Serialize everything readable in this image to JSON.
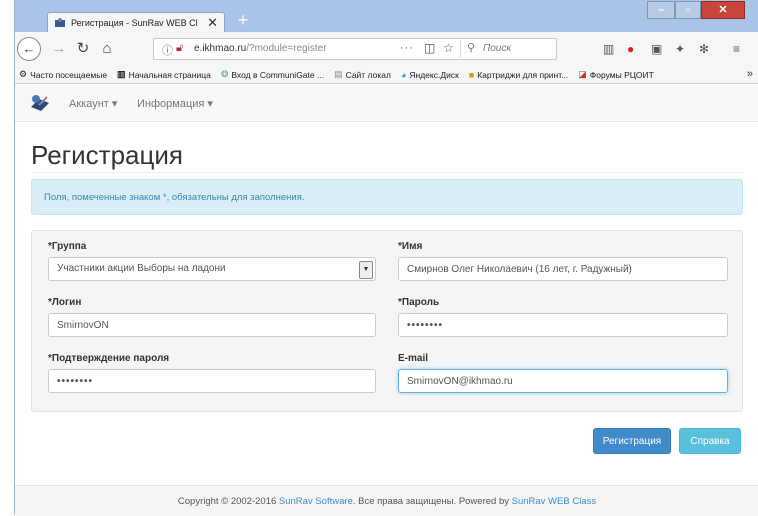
{
  "browser": {
    "tab_title": "Регистрация - SunRav WEB Cl",
    "tab_close": "✕",
    "new_tab": "+",
    "url_prefix": "e.ikhmao.ru",
    "url_path": "/?module=register",
    "url_more": "···",
    "search_placeholder": "Поиск",
    "bookmarks": [
      {
        "label": "Часто посещаемые",
        "icon": "gear-icon"
      },
      {
        "label": "Начальная страница",
        "icon": "start-page-icon"
      },
      {
        "label": "Вход в CommuniGate ...",
        "icon": "communigate-icon"
      },
      {
        "label": "Сайт локал",
        "icon": "page-icon"
      },
      {
        "label": "Яндекс.Диск",
        "icon": "disk-icon"
      },
      {
        "label": "Картриджи для принт...",
        "icon": "folder-icon"
      },
      {
        "label": "Форумы РЦОИТ",
        "icon": "forum-icon"
      }
    ],
    "bookmarks_more": "»"
  },
  "header": {
    "menu_account": "Аккаунт ▾",
    "menu_info": "Информация ▾"
  },
  "page": {
    "title": "Регистрация",
    "alert": "Поля, помеченные знаком *, обязательны для заполнения."
  },
  "form": {
    "group_label": "*Группа",
    "group_value": "Участники акции Выборы на ладони",
    "name_label": "*Имя",
    "name_value": "Смирнов Олег Николаевич (16 лет, г. Радужный)",
    "login_label": "*Логин",
    "login_value": "SmirnovON",
    "password_label": "*Пароль",
    "password_value": "••••••••",
    "confirm_label": "*Подтверждение пароля",
    "confirm_value": "••••••••",
    "email_label": "E-mail",
    "email_value": "SmirnovON@ikhmao.ru"
  },
  "buttons": {
    "register": "Регистрация",
    "help": "Справка"
  },
  "footer": {
    "text1": "Copyright © 2002-2016 ",
    "link1": "SunRav Software",
    "text2": ". Все права защищены. Powered by ",
    "link2": "SunRav WEB Class"
  },
  "colors": {
    "primary": "#428bca",
    "info": "#5bc0de",
    "alert_bg": "#d9edf7"
  }
}
